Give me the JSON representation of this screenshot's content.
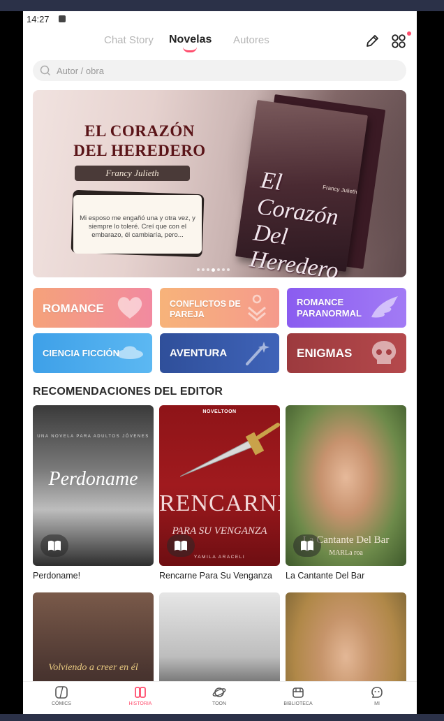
{
  "status_bar": {
    "time": "14:27"
  },
  "header": {
    "tabs": [
      {
        "label": "Chat Story",
        "active": false
      },
      {
        "label": "Novelas",
        "active": true
      },
      {
        "label": "Autores",
        "active": false
      }
    ],
    "icons": [
      "edit-icon",
      "apps-grid-icon"
    ],
    "accent_color": "#ff4d6d"
  },
  "search": {
    "placeholder": "Autor / obra",
    "value": ""
  },
  "banner": {
    "title": "EL CORAZÓN DEL HEREDERO",
    "author": "Francy Julieth",
    "quote": "Mi esposo me engañó una y otra vez, y siempre lo toleré. Creí que con el embarazo, él cambiaría, pero...",
    "book_title": "El Corazón Del Heredero",
    "book_author": "Francy Julieth",
    "slides_total": 7,
    "slide_active": 4
  },
  "genres": [
    {
      "label": "ROMANCE",
      "color_from": "#f5a27a",
      "color_to": "#f28aa0",
      "icon": "heart-icon"
    },
    {
      "label": "CONFLICTOS DE PAREJA",
      "color_from": "#f7b37a",
      "color_to": "#f59a8c",
      "icon": "couple-arrows-icon"
    },
    {
      "label": "ROMANCE PARANORMAL",
      "color_from": "#8a5cf0",
      "color_to": "#a27bf5",
      "icon": "wing-icon"
    },
    {
      "label": "CIENCIA FICCIÓN",
      "color_from": "#3ea0e8",
      "color_to": "#5cb8f2",
      "icon": "ufo-icon"
    },
    {
      "label": "AVENTURA",
      "color_from": "#2f4f9a",
      "color_to": "#3f63b8",
      "icon": "magic-wand-icon"
    },
    {
      "label": "ENIGMAS",
      "color_from": "#9c3a3e",
      "color_to": "#b5494c",
      "icon": "skull-icon"
    }
  ],
  "recommendations": {
    "title": "RECOMENDACIONES DEL EDITOR",
    "books": [
      {
        "title": "Perdoname!",
        "cover_text": "Perdoname",
        "cover_subtitle": "UNA NOVELA PARA ADULTOS JÓVENES"
      },
      {
        "title": "Rencarne Para Su Venganza",
        "cover_text": "RENCARNE",
        "cover_subtitle": "PARA SU VENGANZA",
        "cover_brand": "NOVELTOON",
        "cover_author": "YAMILA ARACELI"
      },
      {
        "title": "La Cantante Del Bar",
        "cover_text": "La Cantante Del Bar",
        "cover_author": "MARLa roa"
      },
      {
        "title": "",
        "cover_text": "Volviendo a creer en él"
      },
      {
        "title": "",
        "cover_text": ""
      },
      {
        "title": "",
        "cover_text": ""
      }
    ]
  },
  "bottom_nav": [
    {
      "label": "CÓMICS",
      "icon": "comics-icon",
      "active": false
    },
    {
      "label": "HISTORIA",
      "icon": "book-open-icon",
      "active": true
    },
    {
      "label": "TOON",
      "icon": "planet-icon",
      "active": false
    },
    {
      "label": "BIBLIOTECA",
      "icon": "library-icon",
      "active": false
    },
    {
      "label": "MI",
      "icon": "chat-face-icon",
      "active": false
    }
  ]
}
